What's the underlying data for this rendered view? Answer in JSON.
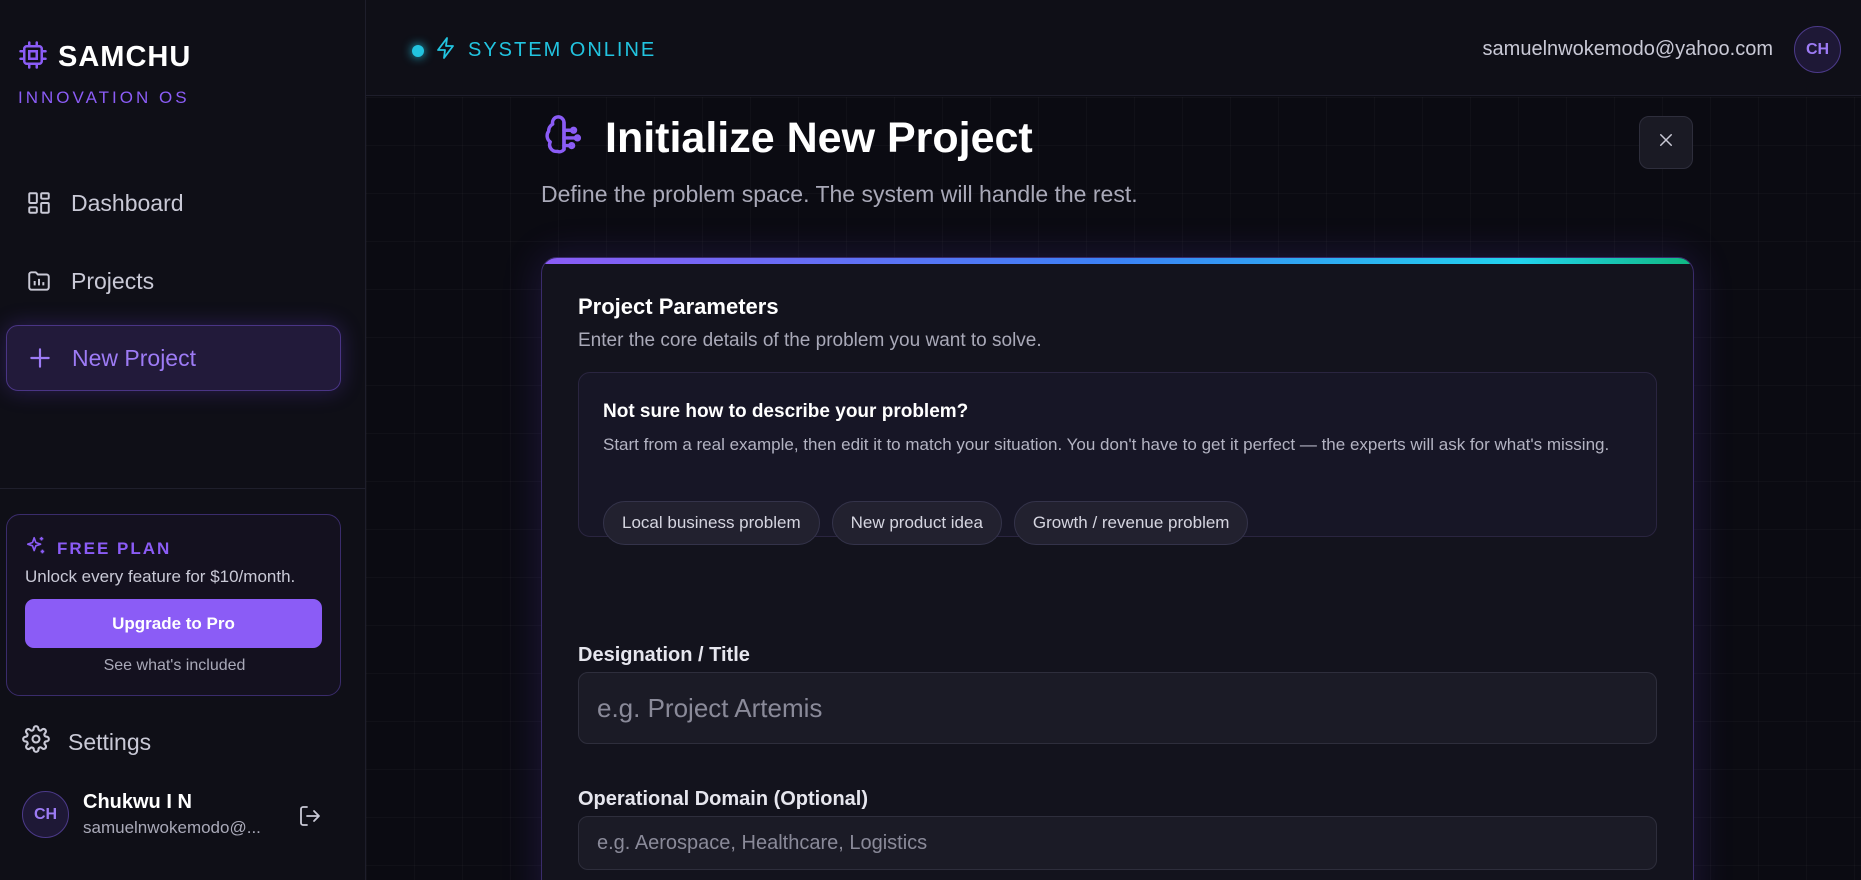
{
  "brand": {
    "name": "SAMCHU",
    "subtitle": "INNOVATION OS"
  },
  "sidebar": {
    "items": [
      {
        "label": "Dashboard",
        "icon": "dashboard-icon"
      },
      {
        "label": "Projects",
        "icon": "folder-icon"
      },
      {
        "label": "New Project",
        "icon": "plus-icon",
        "active": true
      }
    ],
    "plan": {
      "label": "FREE PLAN",
      "text": "Unlock every feature for $10/month.",
      "button": "Upgrade to Pro",
      "link": "See what's included"
    },
    "settings_label": "Settings",
    "user": {
      "initials": "CH",
      "name": "Chukwu I N",
      "email": "samuelnwokemodo@..."
    }
  },
  "topbar": {
    "status": "SYSTEM ONLINE",
    "email": "samuelnwokemodo@yahoo.com",
    "avatar_initials": "CH"
  },
  "page": {
    "title": "Initialize New Project",
    "subtitle": "Define the problem space. The system will handle the rest."
  },
  "card": {
    "title": "Project Parameters",
    "subtitle": "Enter the core details of the problem you want to solve.",
    "help": {
      "title": "Not sure how to describe your problem?",
      "text": "Start from a real example, then edit it to match your situation. You don't have to get it perfect — the experts will ask for what's missing.",
      "chips": [
        "Local business problem",
        "New product idea",
        "Growth / revenue problem"
      ]
    },
    "fields": {
      "title": {
        "label": "Designation / Title",
        "placeholder": "e.g. Project Artemis",
        "value": ""
      },
      "domain": {
        "label": "Operational Domain (Optional)",
        "placeholder": "e.g. Aerospace, Healthcare, Logistics",
        "value": ""
      }
    }
  },
  "colors": {
    "accent": "#8b5cf6",
    "status": "#22c4e0",
    "background": "#0b0b12"
  }
}
